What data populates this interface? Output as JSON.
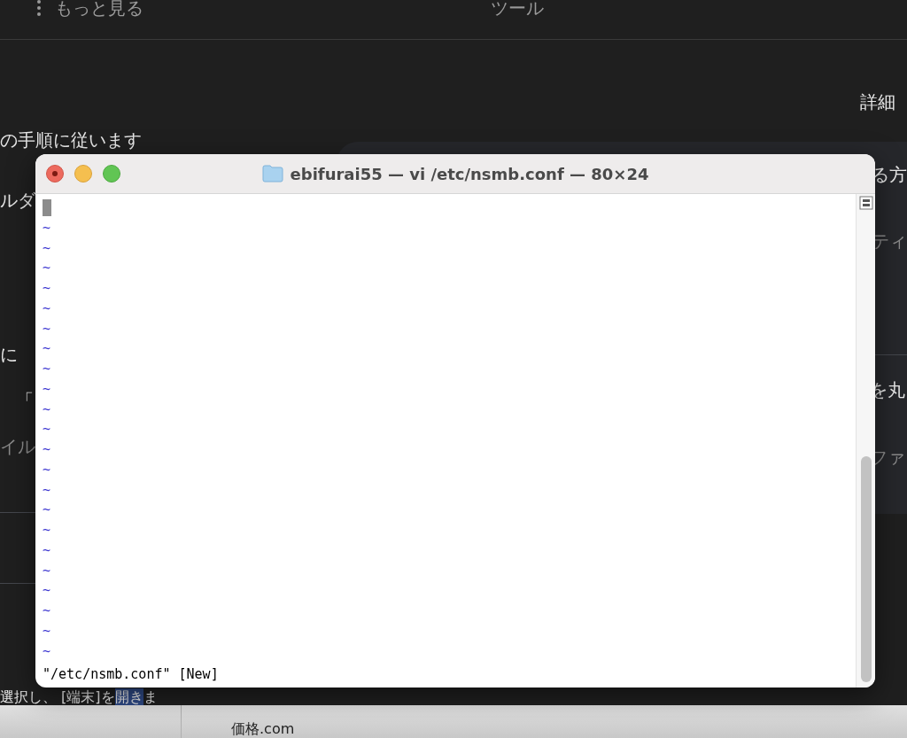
{
  "background_page": {
    "header": {
      "more": "もっと見る",
      "tools": "ツール"
    },
    "fragments": [
      "詳細",
      "の手順に従います",
      "ルダ",
      "る方",
      "ティ",
      "に",
      "「",
      "イル",
      "を丸",
      "ファ"
    ],
    "bottom_line": [
      {
        "text": "選択し、 [端末]を",
        "selected": false
      },
      {
        "text": "開き",
        "selected": true
      },
      {
        "text": "ま",
        "selected": false
      }
    ],
    "footer_link": "価格.com"
  },
  "terminal": {
    "title": "ebifurai55 — vi /etc/nsmb.conf — 80×24",
    "empty_lines": [
      "~",
      "~",
      "~",
      "~",
      "~",
      "~",
      "~",
      "~",
      "~",
      "~",
      "~",
      "~",
      "~",
      "~",
      "~",
      "~",
      "~",
      "~",
      "~",
      "~",
      "~",
      "~"
    ],
    "status": "\"/etc/nsmb.conf\" [New]"
  }
}
